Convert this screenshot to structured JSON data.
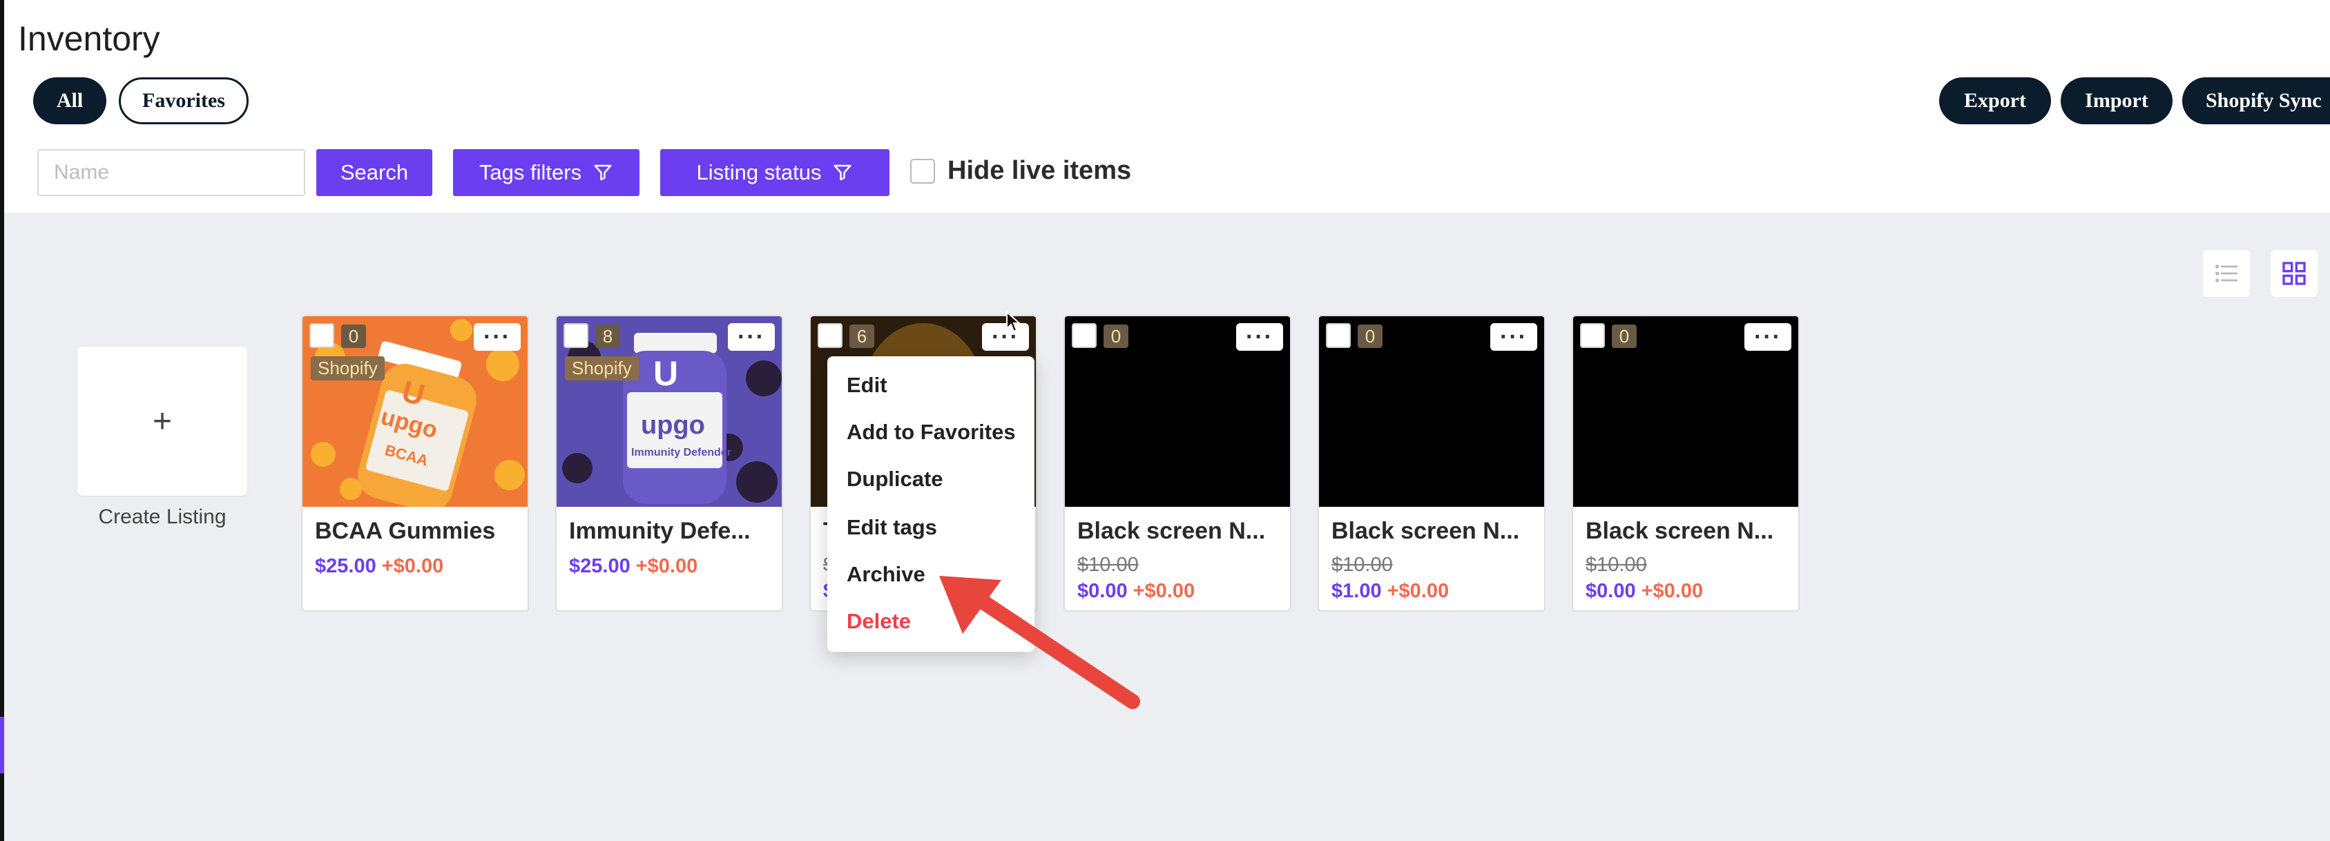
{
  "page": {
    "title": "Inventory"
  },
  "filters": {
    "all_label": "All",
    "favorites_label": "Favorites"
  },
  "actions": {
    "export_label": "Export",
    "import_label": "Import",
    "shopify_sync_label": "Shopify Sync"
  },
  "search": {
    "placeholder": "Name",
    "value": "",
    "button_label": "Search"
  },
  "tag_filters": {
    "label": "Tags filters",
    "icon": "filter-icon"
  },
  "listing_status": {
    "label": "Listing status",
    "icon": "filter-icon"
  },
  "hide_live": {
    "label": "Hide live items",
    "checked": false
  },
  "view_toggle": {
    "list_icon": "list-view-icon",
    "grid_icon": "grid-view-icon",
    "active": "grid"
  },
  "create_listing": {
    "plus": "+",
    "label": "Create Listing"
  },
  "products": [
    {
      "title": "BCAA Gummies",
      "count": "0",
      "source": "Shopify",
      "original_price": "",
      "price": "$25.00",
      "extra": "+$0.00",
      "image": "bcaa-product-image"
    },
    {
      "title": "Immunity Defe...",
      "count": "8",
      "source": "Shopify",
      "original_price": "",
      "price": "$25.00",
      "extra": "+$0.00",
      "image": "immunity-product-image"
    },
    {
      "title": "T",
      "count": "6",
      "source": "",
      "original_price": "$",
      "price": "$",
      "extra": "",
      "image": "dark-product-image"
    },
    {
      "title": "Black screen N...",
      "count": "0",
      "source": "",
      "original_price": "$10.00",
      "price": "$0.00",
      "extra": "+$0.00",
      "image": "black-image"
    },
    {
      "title": "Black screen N...",
      "count": "0",
      "source": "",
      "original_price": "$10.00",
      "price": "$1.00",
      "extra": "+$0.00",
      "image": "black-image"
    },
    {
      "title": "Black screen N...",
      "count": "0",
      "source": "",
      "original_price": "$10.00",
      "price": "$0.00",
      "extra": "+$0.00",
      "image": "black-image"
    }
  ],
  "context_menu": {
    "items": [
      "Edit",
      "Add to Favorites",
      "Duplicate",
      "Edit tags",
      "Archive",
      "Delete"
    ]
  },
  "colors": {
    "accent": "#6b3ef0",
    "dark_pill": "#0b1c2c",
    "delete": "#f03e47",
    "price_extra": "#f06a4e",
    "annotation_arrow": "#e8453c"
  }
}
